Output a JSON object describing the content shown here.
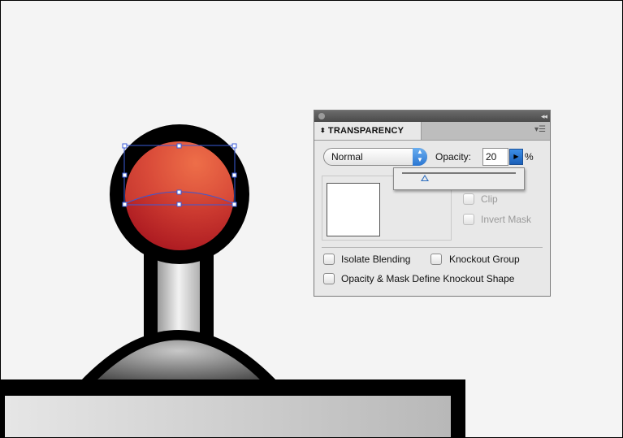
{
  "panel": {
    "tab_label": "TRANSPARENCY",
    "tab_arrows": "⬍",
    "collapse_glyph": "◂◂",
    "menu_glyph": "▾☰",
    "blend_mode": "Normal",
    "opacity_label": "Opacity:",
    "opacity_value": "20",
    "opacity_unit": "%",
    "opacity_fraction": 0.2,
    "checkboxes": {
      "clip": "Clip",
      "invert_mask": "Invert Mask",
      "isolate_blending": "Isolate Blending",
      "knockout_group": "Knockout Group",
      "opacity_mask_knockout": "Opacity & Mask Define Knockout Shape"
    }
  },
  "icons": {
    "close": "panel-close-icon",
    "collapse": "double-chevron-icon",
    "menu": "panel-menu-icon",
    "stepper": "up-down-arrows-icon",
    "popup": "triangle-right-icon",
    "slider": "triangle-up-icon"
  },
  "colors": {
    "selection": "#3a5bd9",
    "accent": "#2a76d2",
    "ball_top": "#e0593a",
    "ball_bottom": "#b01822"
  }
}
